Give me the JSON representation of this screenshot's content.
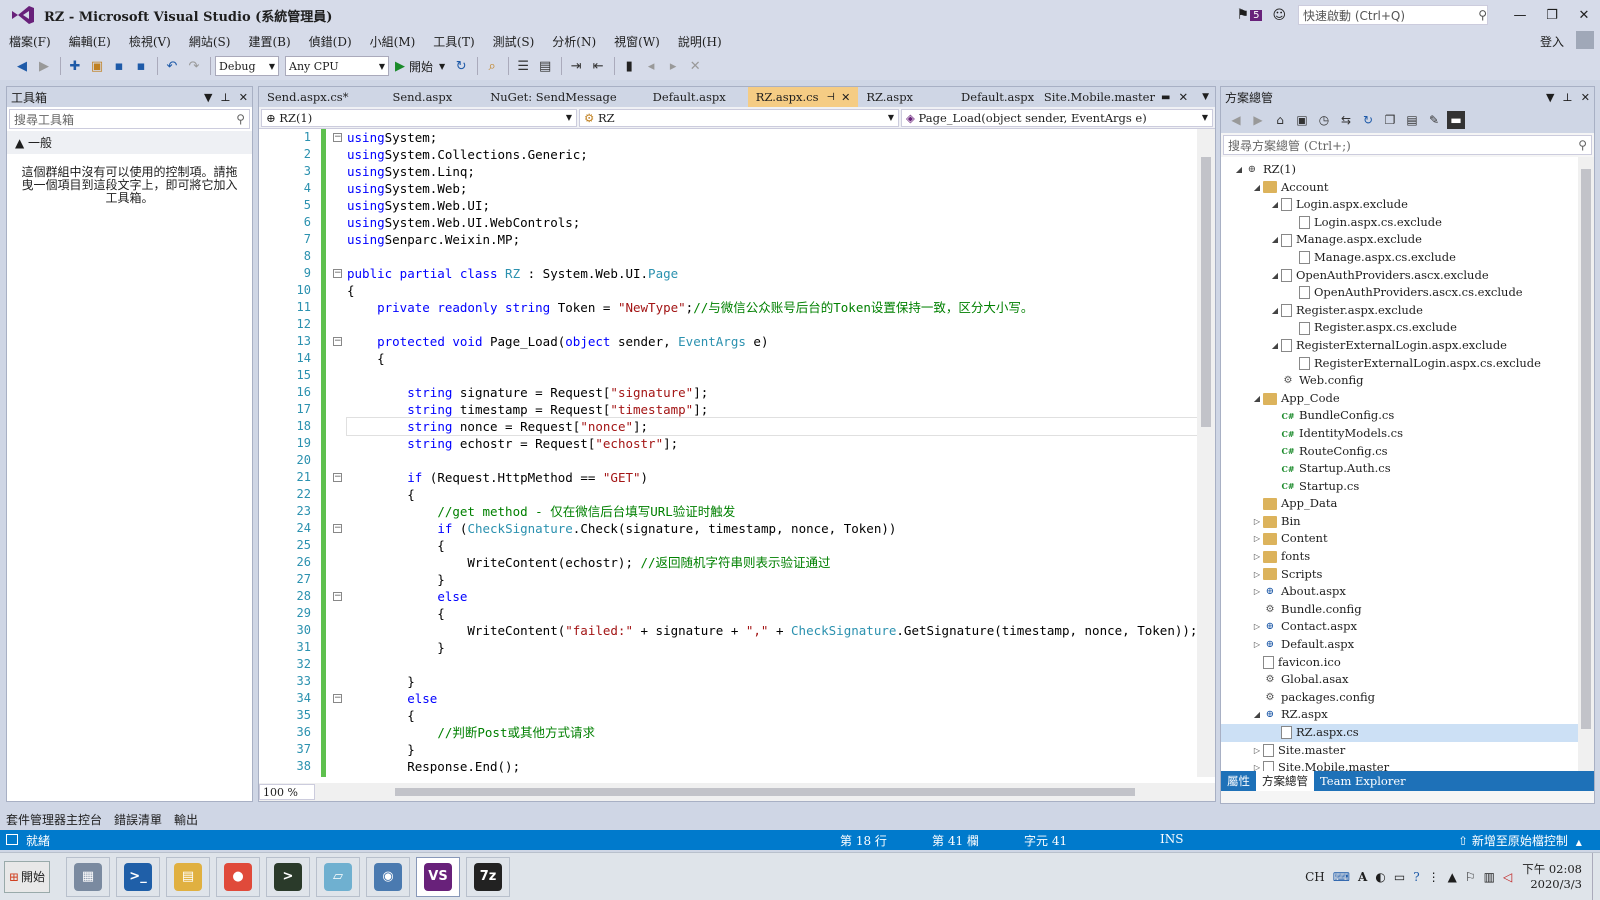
{
  "window": {
    "title": "RZ - Microsoft Visual Studio (系統管理員)",
    "notification_count": "5",
    "quick_launch_placeholder": "快速啟動 (Ctrl+Q)",
    "login_label": "登入"
  },
  "menu": [
    "檔案(F)",
    "編輯(E)",
    "檢視(V)",
    "網站(S)",
    "建置(B)",
    "偵錯(D)",
    "小組(M)",
    "工具(T)",
    "測試(S)",
    "分析(N)",
    "視窗(W)",
    "說明(H)"
  ],
  "toolbar": {
    "config": "Debug",
    "platform": "Any CPU",
    "start_label": "開始"
  },
  "toolbox": {
    "title": "工具箱",
    "search_placeholder": "搜尋工具箱",
    "group": "▲ 一般",
    "empty_text": "這個群組中沒有可以使用的控制項。請拖曳一個項目到這段文字上，即可將它加入工具箱。"
  },
  "editor": {
    "tabs": [
      {
        "label": "Send.aspx.cs*"
      },
      {
        "label": "Send.aspx"
      },
      {
        "label": "NuGet: SendMessage"
      },
      {
        "label": "Default.aspx"
      },
      {
        "label": "RZ.aspx.cs",
        "active": true
      },
      {
        "label": "RZ.aspx"
      },
      {
        "label": "Default.aspx"
      }
    ],
    "pinned_tab": "Site.Mobile.master",
    "nav_project": "RZ(1)",
    "nav_class": "RZ",
    "nav_member": "Page_Load(object sender, EventArgs e)",
    "zoom": "100 %",
    "current_line": 18
  },
  "code_lines": [
    [
      [
        "kw",
        "using"
      ],
      [
        "",
        "System;"
      ]
    ],
    [
      [
        "kw",
        "using"
      ],
      [
        "",
        "System.Collections.Generic;"
      ]
    ],
    [
      [
        "kw",
        "using"
      ],
      [
        "",
        "System.Linq;"
      ]
    ],
    [
      [
        "kw",
        "using"
      ],
      [
        "",
        "System.Web;"
      ]
    ],
    [
      [
        "kw",
        "using"
      ],
      [
        "",
        "System.Web.UI;"
      ]
    ],
    [
      [
        "kw",
        "using"
      ],
      [
        "",
        "System.Web.UI.WebControls;"
      ]
    ],
    [
      [
        "kw",
        "using"
      ],
      [
        "",
        "Senparc.Weixin.MP;"
      ]
    ],
    [],
    [
      [
        "kw",
        "public partial class "
      ],
      [
        "ty",
        "RZ"
      ],
      [
        "",
        " : System.Web.UI."
      ],
      [
        "ty",
        "Page"
      ]
    ],
    [
      [
        "",
        "{"
      ]
    ],
    [
      [
        "",
        "    "
      ],
      [
        "kw",
        "private readonly string"
      ],
      [
        "",
        " Token = "
      ],
      [
        "st",
        "\"NewType\""
      ],
      [
        "",
        ";"
      ],
      [
        "cm",
        "//与微信公众账号后台的Token设置保持一致，区分大小写。"
      ]
    ],
    [],
    [
      [
        "",
        "    "
      ],
      [
        "kw",
        "protected void"
      ],
      [
        "",
        " Page_Load("
      ],
      [
        "kw",
        "object"
      ],
      [
        "",
        " sender, "
      ],
      [
        "ty",
        "EventArgs"
      ],
      [
        "",
        " e)"
      ]
    ],
    [
      [
        "",
        "    {"
      ]
    ],
    [],
    [
      [
        "",
        "        "
      ],
      [
        "kw",
        "string"
      ],
      [
        "",
        " signature = Request["
      ],
      [
        "st",
        "\"signature\""
      ],
      [
        "",
        "];"
      ]
    ],
    [
      [
        "",
        "        "
      ],
      [
        "kw",
        "string"
      ],
      [
        "",
        " timestamp = Request["
      ],
      [
        "st",
        "\"timestamp\""
      ],
      [
        "",
        "];"
      ]
    ],
    [
      [
        "",
        "        "
      ],
      [
        "kw",
        "string"
      ],
      [
        "",
        " nonce = Request["
      ],
      [
        "st",
        "\"nonce\""
      ],
      [
        "",
        "];"
      ]
    ],
    [
      [
        "",
        "        "
      ],
      [
        "kw",
        "string"
      ],
      [
        "",
        " echostr = Request["
      ],
      [
        "st",
        "\"echostr\""
      ],
      [
        "",
        "];"
      ]
    ],
    [],
    [
      [
        "",
        "        "
      ],
      [
        "kw",
        "if"
      ],
      [
        "",
        " (Request.HttpMethod == "
      ],
      [
        "st",
        "\"GET\""
      ],
      [
        "",
        ")"
      ]
    ],
    [
      [
        "",
        "        {"
      ]
    ],
    [
      [
        "",
        "            "
      ],
      [
        "cm",
        "//get method - 仅在微信后台填写URL验证时触发"
      ]
    ],
    [
      [
        "",
        "            "
      ],
      [
        "kw",
        "if"
      ],
      [
        "",
        " ("
      ],
      [
        "ty",
        "CheckSignature"
      ],
      [
        "",
        ".Check(signature, timestamp, nonce, Token))"
      ]
    ],
    [
      [
        "",
        "            {"
      ]
    ],
    [
      [
        "",
        "                WriteContent(echostr); "
      ],
      [
        "cm",
        "//返回随机字符串则表示验证通过"
      ]
    ],
    [
      [
        "",
        "            }"
      ]
    ],
    [
      [
        "",
        "            "
      ],
      [
        "kw",
        "else"
      ]
    ],
    [
      [
        "",
        "            {"
      ]
    ],
    [
      [
        "",
        "                WriteContent("
      ],
      [
        "st",
        "\"failed:\""
      ],
      [
        "",
        " + signature + "
      ],
      [
        "st",
        "\",\""
      ],
      [
        "",
        " + "
      ],
      [
        "ty",
        "CheckSignature"
      ],
      [
        "",
        ".GetSignature(timestamp, nonce, Token));"
      ]
    ],
    [
      [
        "",
        "            }"
      ]
    ],
    [],
    [
      [
        "",
        "        }"
      ]
    ],
    [
      [
        "",
        "        "
      ],
      [
        "kw",
        "else"
      ]
    ],
    [
      [
        "",
        "        {"
      ]
    ],
    [
      [
        "",
        "            "
      ],
      [
        "cm",
        "//判断Post或其他方式请求"
      ]
    ],
    [
      [
        "",
        "        }"
      ]
    ],
    [
      [
        "",
        "        Response.End();"
      ]
    ],
    [
      [
        "",
        "    }"
      ]
    ]
  ],
  "solution": {
    "title": "方案總管",
    "search_placeholder": "搜尋方案總管 (Ctrl+;)",
    "tree": [
      {
        "label": "RZ(1)",
        "level": 0,
        "icon": "proj",
        "exp": "open"
      },
      {
        "label": "Account",
        "level": 1,
        "icon": "folder",
        "exp": "open"
      },
      {
        "label": "Login.aspx.exclude",
        "level": 2,
        "icon": "file",
        "exp": "open"
      },
      {
        "label": "Login.aspx.cs.exclude",
        "level": 3,
        "icon": "file",
        "exp": ""
      },
      {
        "label": "Manage.aspx.exclude",
        "level": 2,
        "icon": "file",
        "exp": "open"
      },
      {
        "label": "Manage.aspx.cs.exclude",
        "level": 3,
        "icon": "file",
        "exp": ""
      },
      {
        "label": "OpenAuthProviders.ascx.exclude",
        "level": 2,
        "icon": "file",
        "exp": "open"
      },
      {
        "label": "OpenAuthProviders.ascx.cs.exclude",
        "level": 3,
        "icon": "file",
        "exp": ""
      },
      {
        "label": "Register.aspx.exclude",
        "level": 2,
        "icon": "file",
        "exp": "open"
      },
      {
        "label": "Register.aspx.cs.exclude",
        "level": 3,
        "icon": "file",
        "exp": ""
      },
      {
        "label": "RegisterExternalLogin.aspx.exclude",
        "level": 2,
        "icon": "file",
        "exp": "open"
      },
      {
        "label": "RegisterExternalLogin.aspx.cs.exclude",
        "level": 3,
        "icon": "file",
        "exp": ""
      },
      {
        "label": "Web.config",
        "level": 2,
        "icon": "cfg",
        "exp": ""
      },
      {
        "label": "App_Code",
        "level": 1,
        "icon": "folder",
        "exp": "open"
      },
      {
        "label": "BundleConfig.cs",
        "level": 2,
        "icon": "cs",
        "exp": ""
      },
      {
        "label": "IdentityModels.cs",
        "level": 2,
        "icon": "cs",
        "exp": ""
      },
      {
        "label": "RouteConfig.cs",
        "level": 2,
        "icon": "cs",
        "exp": ""
      },
      {
        "label": "Startup.Auth.cs",
        "level": 2,
        "icon": "cs",
        "exp": ""
      },
      {
        "label": "Startup.cs",
        "level": 2,
        "icon": "cs",
        "exp": ""
      },
      {
        "label": "App_Data",
        "level": 1,
        "icon": "folder",
        "exp": ""
      },
      {
        "label": "Bin",
        "level": 1,
        "icon": "folder",
        "exp": "closed"
      },
      {
        "label": "Content",
        "level": 1,
        "icon": "folder",
        "exp": "closed"
      },
      {
        "label": "fonts",
        "level": 1,
        "icon": "folder",
        "exp": "closed"
      },
      {
        "label": "Scripts",
        "level": 1,
        "icon": "folder",
        "exp": "closed"
      },
      {
        "label": "About.aspx",
        "level": 1,
        "icon": "web",
        "exp": "closed"
      },
      {
        "label": "Bundle.config",
        "level": 1,
        "icon": "cfg",
        "exp": ""
      },
      {
        "label": "Contact.aspx",
        "level": 1,
        "icon": "web",
        "exp": "closed"
      },
      {
        "label": "Default.aspx",
        "level": 1,
        "icon": "web",
        "exp": "closed"
      },
      {
        "label": "favicon.ico",
        "level": 1,
        "icon": "file",
        "exp": ""
      },
      {
        "label": "Global.asax",
        "level": 1,
        "icon": "cfg",
        "exp": ""
      },
      {
        "label": "packages.config",
        "level": 1,
        "icon": "cfg",
        "exp": ""
      },
      {
        "label": "RZ.aspx",
        "level": 1,
        "icon": "web",
        "exp": "open"
      },
      {
        "label": "RZ.aspx.cs",
        "level": 2,
        "icon": "file",
        "exp": "",
        "selected": true
      },
      {
        "label": "Site.master",
        "level": 1,
        "icon": "file",
        "exp": "closed"
      },
      {
        "label": "Site.Mobile.master",
        "level": 1,
        "icon": "file",
        "exp": "closed"
      }
    ],
    "bottom_tabs": [
      "屬性",
      "方案總管",
      "Team Explorer"
    ]
  },
  "bottom_dock_tabs": [
    "套件管理器主控台",
    "錯誤清單",
    "輸出"
  ],
  "status": {
    "ready": "就緒",
    "line": "第 18 行",
    "col": "第 41 欄",
    "char": "字元 41",
    "mode": "INS",
    "publish": "新增至原始檔控制"
  },
  "taskbar": {
    "start_label": "開始",
    "apps": [
      {
        "name": "server-manager",
        "color": "#7a8aa0",
        "glyph": "▦"
      },
      {
        "name": "powershell",
        "color": "#1f5fa8",
        "glyph": ">_"
      },
      {
        "name": "file-explorer",
        "color": "#e0b040",
        "glyph": "▤"
      },
      {
        "name": "chrome",
        "color": "#e04a3a",
        "glyph": "●"
      },
      {
        "name": "cmd",
        "color": "#2a3a2a",
        "glyph": ">"
      },
      {
        "name": "notepad",
        "color": "#6fb0d0",
        "glyph": "▱"
      },
      {
        "name": "network",
        "color": "#4a7ab0",
        "glyph": "◉"
      },
      {
        "name": "visual-studio",
        "color": "#68217a",
        "glyph": "VS"
      },
      {
        "name": "7zip",
        "color": "#222",
        "glyph": "7z"
      }
    ],
    "lang": "CH",
    "time": "下午 02:08",
    "date": "2020/3/3"
  }
}
